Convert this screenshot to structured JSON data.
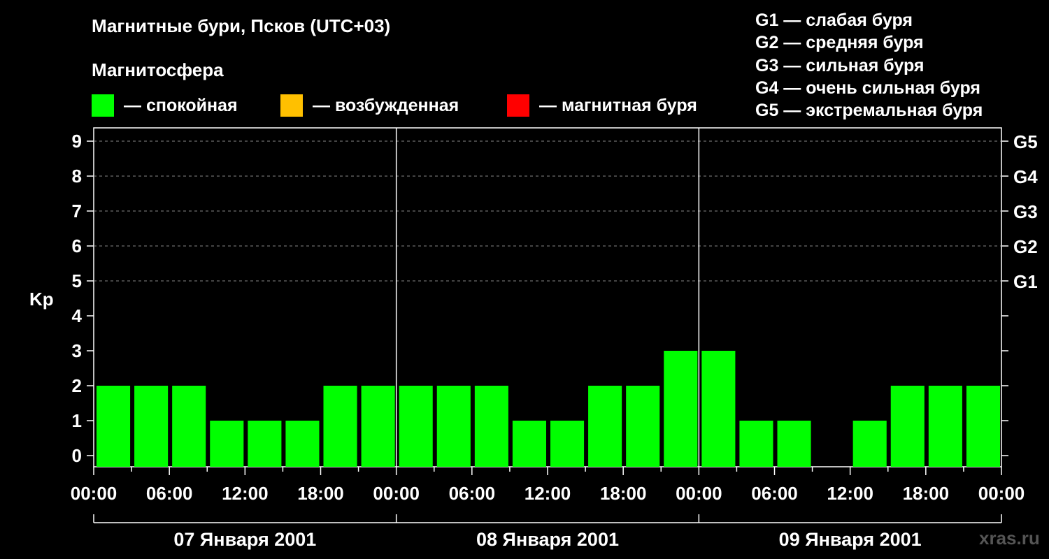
{
  "title": "Магнитные бури, Псков (UTC+03)",
  "subtitle": "Магнитосфера",
  "legend": [
    {
      "label": "— спокойная",
      "color": "#00ff00"
    },
    {
      "label": "— возбужденная",
      "color": "#ffc000"
    },
    {
      "label": "— магнитная буря",
      "color": "#ff0000"
    }
  ],
  "g_legend": [
    "G1 — слабая буря",
    "G2 — средняя буря",
    "G3 — сильная буря",
    "G4 — очень сильная буря",
    "G5 — экстремальная буря"
  ],
  "watermark": "xras.ru",
  "chart_data": {
    "type": "bar",
    "ylabel": "Kp",
    "ylim": [
      0,
      9
    ],
    "y_ticks": [
      "0",
      "1",
      "2",
      "3",
      "4",
      "5",
      "6",
      "7",
      "8",
      "9"
    ],
    "right_axis_labels": [
      {
        "kp": 5,
        "label": "G1"
      },
      {
        "kp": 6,
        "label": "G2"
      },
      {
        "kp": 7,
        "label": "G3"
      },
      {
        "kp": 8,
        "label": "G4"
      },
      {
        "kp": 9,
        "label": "G5"
      }
    ],
    "x_tick_labels": [
      "00:00",
      "06:00",
      "12:00",
      "18:00",
      "00:00",
      "06:00",
      "12:00",
      "18:00",
      "00:00",
      "06:00",
      "12:00",
      "18:00",
      "00:00"
    ],
    "days": [
      "07 Января 2001",
      "08 Января 2001",
      "09 Января 2001"
    ],
    "interval_hours": 3,
    "values": [
      2,
      2,
      2,
      1,
      1,
      1,
      2,
      2,
      2,
      2,
      2,
      1,
      1,
      2,
      2,
      3,
      3,
      1,
      1,
      0,
      1,
      2,
      2,
      2
    ],
    "bar_color": "#00ff00",
    "grid": true
  }
}
